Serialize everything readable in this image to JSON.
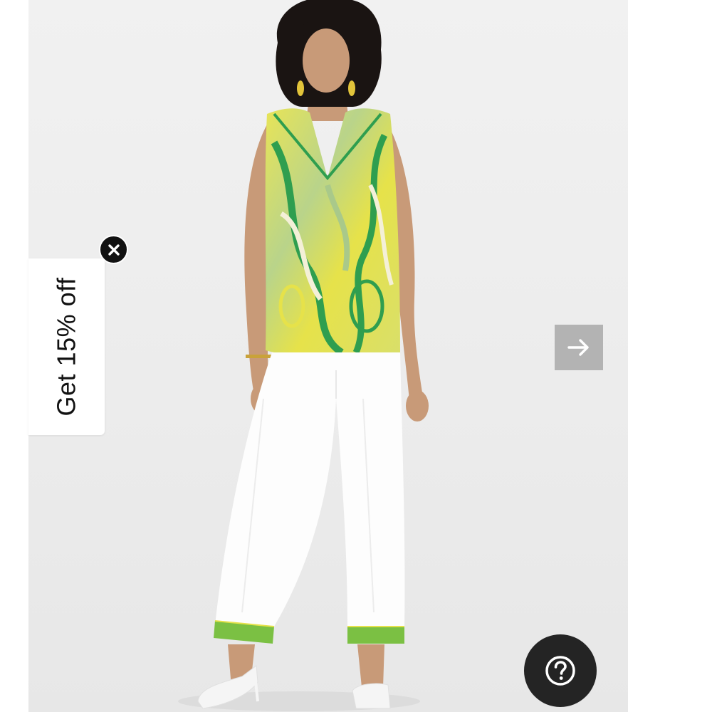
{
  "promo": {
    "label": "Get 15% off",
    "close_icon": "close-icon"
  },
  "gallery": {
    "next_icon": "arrow-right-icon",
    "next_button_color": "#b3b3b3"
  },
  "help": {
    "icon": "question-circle-icon",
    "button_color": "#242424"
  },
  "product": {
    "top_colors": [
      "#e6e24a",
      "#2f9e4f",
      "#a9c98a",
      "#f4f0d8"
    ],
    "trim_color": "#7bc043"
  }
}
